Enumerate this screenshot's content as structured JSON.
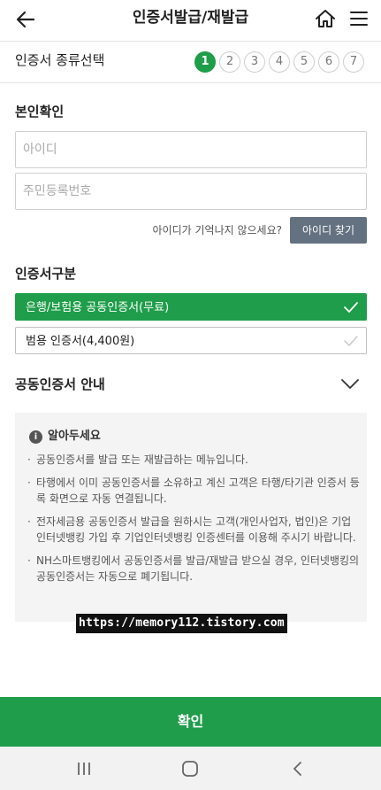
{
  "header": {
    "title": "인증서발급/재발급",
    "back_icon": "arrow-left-icon",
    "home_icon": "home-icon",
    "menu_icon": "hamburger-menu-icon"
  },
  "type_select": {
    "label": "인증서 종류선택",
    "steps": [
      "1",
      "2",
      "3",
      "4",
      "5",
      "6",
      "7"
    ],
    "active_step": "1"
  },
  "identity": {
    "title": "본인확인",
    "id_placeholder": "아이디",
    "resident_placeholder": "주민등록번호",
    "forgot_hint": "아이디가 기억나지 않으세요?",
    "find_id_button": "아이디 찾기"
  },
  "cert_type": {
    "title": "인증서구분",
    "options": [
      {
        "label": "은행/보험용 공동인증서(무료)",
        "selected": true
      },
      {
        "label": "범용 인증서(4,400원)",
        "selected": false
      }
    ]
  },
  "guide": {
    "title": "공동인증서 안내",
    "notice_title": "알아두세요",
    "items": [
      "공동인증서를 발급 또는 재발급하는 메뉴입니다.",
      "타행에서 이미 공동인증서를 소유하고 계신 고객은 타행/타기관 인증서 등록 화면으로 자동 연결됩니다.",
      "전자세금용 공동인증서 발급을 원하시는 고객(개인사업자, 법인)은 기업인터넷뱅킹 가입 후 기업인터넷뱅킹 인증센터를 이용해 주시기 바랍니다.",
      "NH스마트뱅킹에서 공동인증서를 발급/재발급 받으실 경우, 인터넷뱅킹의 공동인증서는 자동으로 폐기됩니다."
    ]
  },
  "watermark": "https://memory112.tistory.com",
  "confirm_button": "확인",
  "colors": {
    "accent_green": "#1f9d4a",
    "find_button": "#637180",
    "notice_bg": "#f4f4f4"
  }
}
